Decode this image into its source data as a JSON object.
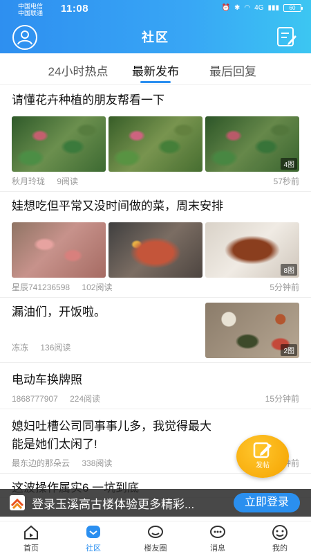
{
  "status_bar": {
    "carrier_1": "中国电信",
    "carrier_2": "中国联通",
    "time": "11:08",
    "signal_text": "4G",
    "battery": "60"
  },
  "header": {
    "title": "社区"
  },
  "tabs": [
    {
      "label": "24小时热点",
      "active": false
    },
    {
      "label": "最新发布",
      "active": true
    },
    {
      "label": "最后回复",
      "active": false
    }
  ],
  "posts": [
    {
      "title": "请懂花卉种植的朋友帮看一下",
      "author": "秋月玲珑",
      "reads": "9阅读",
      "time": "57秒前",
      "image_count": "4图"
    },
    {
      "title": "娃想吃但平常又没时间做的菜，周末安排",
      "author": "星辰741236598",
      "reads": "102阅读",
      "time": "5分钟前",
      "image_count": "8图"
    },
    {
      "title": "漏油们，开饭啦。",
      "author": "冻冻",
      "reads": "136阅读",
      "time": "",
      "image_count": "2图"
    },
    {
      "title": "电动车换牌照",
      "author": "1868777907",
      "reads": "224阅读",
      "time": "15分钟前"
    },
    {
      "title": "媳妇吐槽公司同事事儿多，我觉得最大的原因可能是她们太闲了!",
      "title_visible_1": "媳妇吐槽公司同事事儿多，我觉得最大",
      "title_visible_2": "能是她们太闲了!",
      "author": "最东边的那朵云",
      "reads": "338阅读",
      "time": "37分钟前"
    },
    {
      "title": "这波操作属实6 一坑到底"
    }
  ],
  "fab": {
    "label": "发帖"
  },
  "login_banner": {
    "text": "登录玉溪高古楼体验更多精彩...",
    "button": "立即登录"
  },
  "bottom_nav": [
    {
      "label": "首页",
      "icon": "home-icon",
      "active": false
    },
    {
      "label": "社区",
      "icon": "community-icon",
      "active": true
    },
    {
      "label": "楼友圈",
      "icon": "chat-bubble-icon",
      "active": false
    },
    {
      "label": "消息",
      "icon": "message-icon",
      "active": false
    },
    {
      "label": "我的",
      "icon": "smile-icon",
      "active": false
    }
  ],
  "colors": {
    "accent": "#2b8ff0",
    "fab": "#f7ab10",
    "meta_text": "#999999"
  }
}
